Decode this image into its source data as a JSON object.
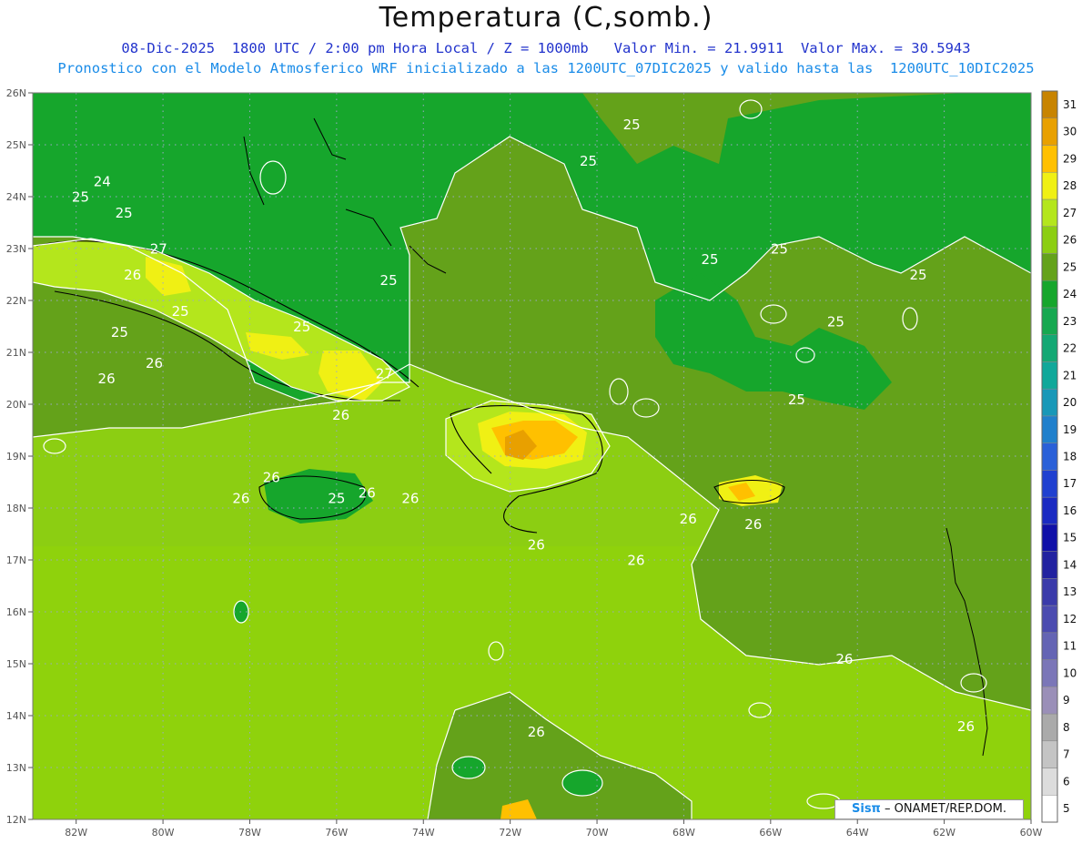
{
  "header": {
    "title": "Temperatura (C,somb.)",
    "subtitle_line1": "08-Dic-2025  1800 UTC / 2:00 pm Hora Local / Z = 1000mb   Valor Min. = 21.9911  Valor Max. = 30.5943",
    "subtitle_line2": "Pronostico con el Modelo Atmosferico WRF inicializado a las 1200UTC_07DIC2025 y valido hasta las  1200UTC_10DIC2025"
  },
  "map": {
    "lon_range": [
      -83,
      -60
    ],
    "lat_range": [
      12,
      26
    ],
    "lon_ticks": [
      {
        "value": -82,
        "label": "82W"
      },
      {
        "value": -80,
        "label": "80W"
      },
      {
        "value": -78,
        "label": "78W"
      },
      {
        "value": -76,
        "label": "76W"
      },
      {
        "value": -74,
        "label": "74W"
      },
      {
        "value": -72,
        "label": "72W"
      },
      {
        "value": -70,
        "label": "70W"
      },
      {
        "value": -68,
        "label": "68W"
      },
      {
        "value": -66,
        "label": "66W"
      },
      {
        "value": -64,
        "label": "64W"
      },
      {
        "value": -62,
        "label": "62W"
      },
      {
        "value": -60,
        "label": "60W"
      }
    ],
    "lat_ticks": [
      {
        "value": 26,
        "label": "26N"
      },
      {
        "value": 25,
        "label": "25N"
      },
      {
        "value": 24,
        "label": "24N"
      },
      {
        "value": 23,
        "label": "23N"
      },
      {
        "value": 22,
        "label": "22N"
      },
      {
        "value": 21,
        "label": "21N"
      },
      {
        "value": 20,
        "label": "20N"
      },
      {
        "value": 19,
        "label": "19N"
      },
      {
        "value": 18,
        "label": "18N"
      },
      {
        "value": 17,
        "label": "17N"
      },
      {
        "value": 16,
        "label": "16N"
      },
      {
        "value": 15,
        "label": "15N"
      },
      {
        "value": 14,
        "label": "14N"
      },
      {
        "value": 13,
        "label": "13N"
      },
      {
        "value": 12,
        "label": "12N"
      }
    ],
    "contour_labels": [
      {
        "text": "25",
        "lon": -69.2,
        "lat": 25.3
      },
      {
        "text": "25",
        "lon": -70.2,
        "lat": 24.6
      },
      {
        "text": "24",
        "lon": -81.4,
        "lat": 24.2
      },
      {
        "text": "25",
        "lon": -81.9,
        "lat": 23.9
      },
      {
        "text": "25",
        "lon": -80.9,
        "lat": 23.6
      },
      {
        "text": "25",
        "lon": -65.8,
        "lat": 22.9
      },
      {
        "text": "25",
        "lon": -67.4,
        "lat": 22.7
      },
      {
        "text": "25",
        "lon": -62.6,
        "lat": 22.4
      },
      {
        "text": "25",
        "lon": -74.8,
        "lat": 22.3
      },
      {
        "text": "26",
        "lon": -80.7,
        "lat": 22.4
      },
      {
        "text": "27",
        "lon": -80.1,
        "lat": 22.9
      },
      {
        "text": "25",
        "lon": -79.6,
        "lat": 21.7
      },
      {
        "text": "25",
        "lon": -76.8,
        "lat": 21.4
      },
      {
        "text": "25",
        "lon": -81.0,
        "lat": 21.3
      },
      {
        "text": "25",
        "lon": -64.5,
        "lat": 21.5
      },
      {
        "text": "26",
        "lon": -80.2,
        "lat": 20.7
      },
      {
        "text": "26",
        "lon": -81.3,
        "lat": 20.4
      },
      {
        "text": "27",
        "lon": -74.9,
        "lat": 20.5
      },
      {
        "text": "25",
        "lon": -65.4,
        "lat": 20.0
      },
      {
        "text": "26",
        "lon": -75.9,
        "lat": 19.7
      },
      {
        "text": "26",
        "lon": -77.5,
        "lat": 18.5
      },
      {
        "text": "26",
        "lon": -78.2,
        "lat": 18.1
      },
      {
        "text": "25",
        "lon": -76.0,
        "lat": 18.1
      },
      {
        "text": "26",
        "lon": -75.3,
        "lat": 18.2
      },
      {
        "text": "26",
        "lon": -74.3,
        "lat": 18.1
      },
      {
        "text": "26",
        "lon": -67.9,
        "lat": 17.7
      },
      {
        "text": "26",
        "lon": -66.4,
        "lat": 17.6
      },
      {
        "text": "26",
        "lon": -71.4,
        "lat": 17.2
      },
      {
        "text": "26",
        "lon": -69.1,
        "lat": 16.9
      },
      {
        "text": "26",
        "lon": -64.3,
        "lat": 15.0
      },
      {
        "text": "26",
        "lon": -71.4,
        "lat": 13.6
      },
      {
        "text": "26",
        "lon": -61.5,
        "lat": 13.7
      }
    ]
  },
  "colorbar": {
    "labels": [
      "5",
      "6",
      "7",
      "8",
      "9",
      "10",
      "11",
      "12",
      "13",
      "14",
      "15",
      "16",
      "17",
      "18",
      "19",
      "20",
      "21",
      "22",
      "23",
      "24",
      "25",
      "26",
      "27",
      "28",
      "29",
      "30",
      "31"
    ],
    "colors": [
      "#ffffff",
      "#dcdcdc",
      "#c4c4c4",
      "#aaaaaa",
      "#9a8fb8",
      "#7b76b8",
      "#6464b4",
      "#4b4bb0",
      "#3a3aaa",
      "#2222a0",
      "#1010a8",
      "#1a2ac2",
      "#2040d0",
      "#2a60d8",
      "#2080cc",
      "#1898b8",
      "#10a89a",
      "#14a874",
      "#16a850",
      "#16a62c",
      "#64a21a",
      "#8cce12",
      "#b4e61c",
      "#f0f014",
      "#ffc000",
      "#e8a000",
      "#c88400"
    ]
  },
  "footer": {
    "logo_sis": "Sisπ",
    "logo_text": " – ONAMET/REP.DOM."
  }
}
